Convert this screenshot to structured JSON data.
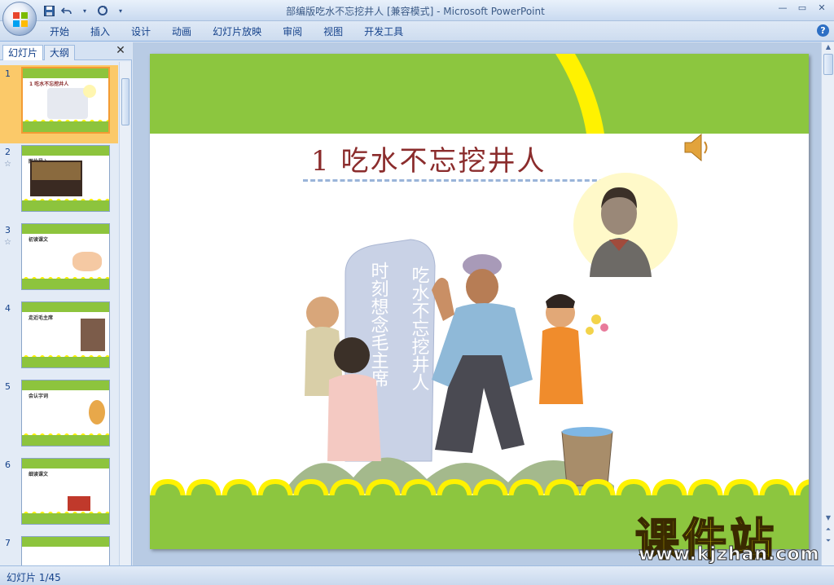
{
  "window": {
    "title": "部编版吃水不忘挖井人 [兼容模式] - Microsoft PowerPoint",
    "minimize": "—",
    "maximize": "▭",
    "close": "✕"
  },
  "quick_access": {
    "save_icon": "save-icon",
    "undo_icon": "undo-icon",
    "redo_icon": "redo-icon"
  },
  "ribbon": {
    "tabs": [
      "开始",
      "插入",
      "设计",
      "动画",
      "幻灯片放映",
      "审阅",
      "视图",
      "开发工具"
    ],
    "help": "?"
  },
  "left_pane": {
    "tab_slides": "幻灯片",
    "tab_outline": "大纲",
    "close": "✕",
    "thumbnails": [
      {
        "num": "1",
        "title": "1 吃水不忘挖井人",
        "selected": true
      },
      {
        "num": "2",
        "title": "图片导入",
        "star": "☆"
      },
      {
        "num": "3",
        "title": "初读课文",
        "star": "☆"
      },
      {
        "num": "4",
        "title": "走近毛主席"
      },
      {
        "num": "5",
        "title": "会认字词"
      },
      {
        "num": "6",
        "title": "细读课文"
      },
      {
        "num": "7",
        "title": ""
      }
    ]
  },
  "slide": {
    "title": "1  吃水不忘挖井人",
    "speaker_icon": "speaker-icon",
    "stone_text_left": "时刻想念毛主席",
    "stone_text_right": "吃水不忘挖井人"
  },
  "watermark": {
    "brand": "课件站",
    "url": "www.kjzhan.com"
  },
  "status_bar": {
    "slide_counter": "幻灯片 1/45"
  },
  "colors": {
    "slide_green": "#8cc63f",
    "slide_yellow": "#fff200",
    "title_red": "#8b2c2c",
    "selection_orange": "#fbc969"
  }
}
